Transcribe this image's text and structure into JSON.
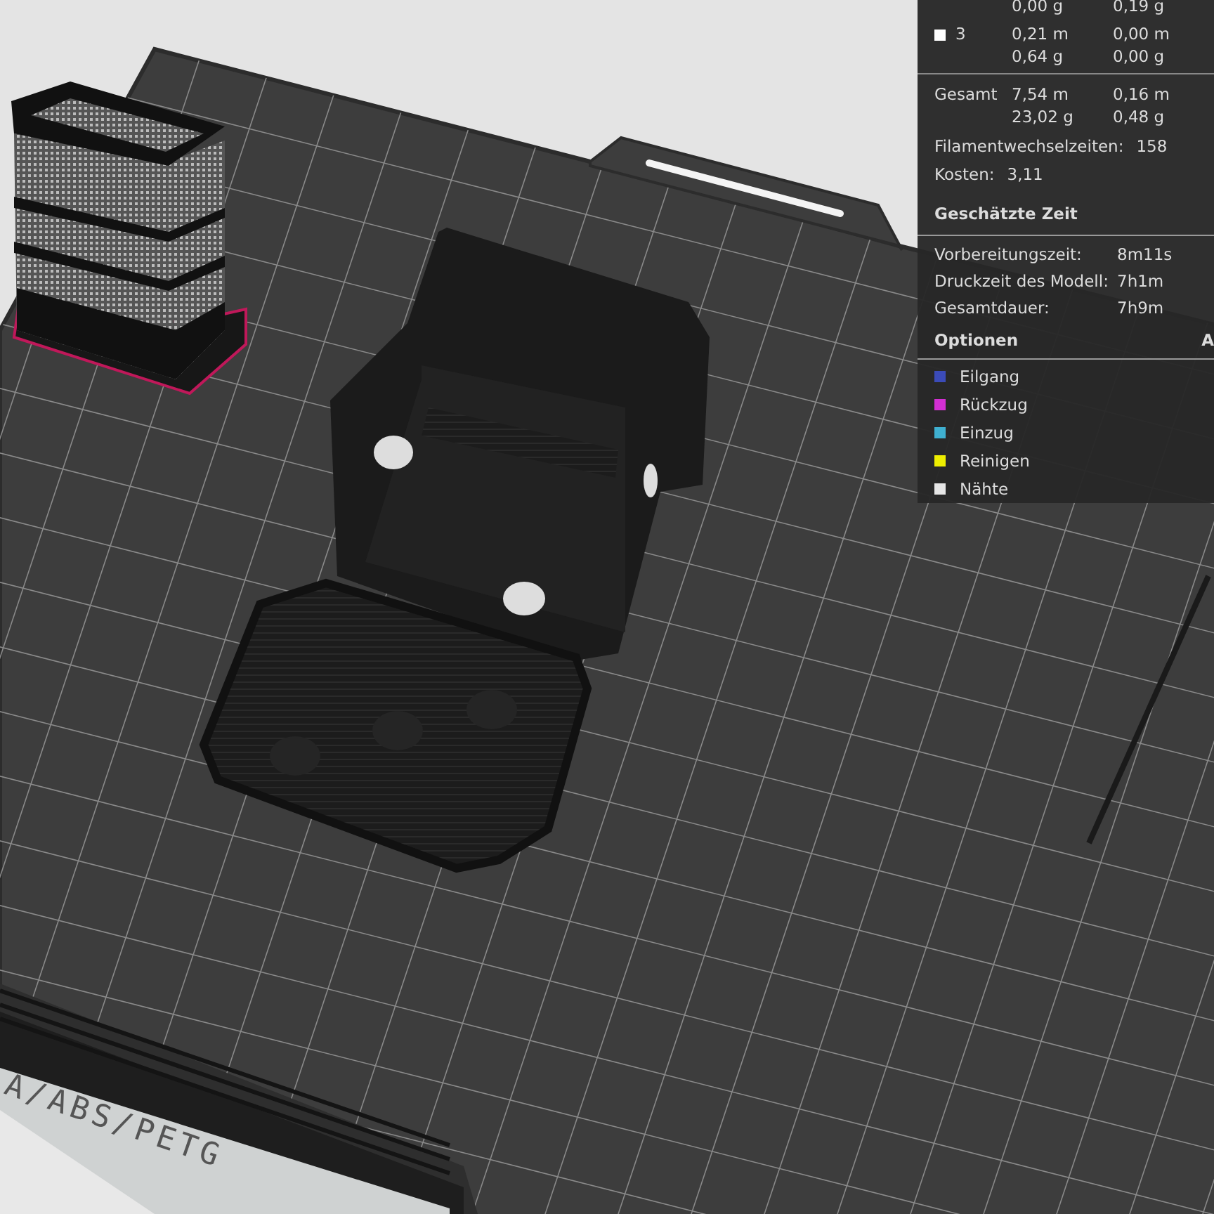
{
  "plate": {
    "label": "A/ABS/PETG"
  },
  "usage": {
    "rows": [
      {
        "kind": "partial",
        "columns": [
          [
            "0,00 g"
          ],
          [
            "0,19 g"
          ]
        ]
      },
      {
        "kind": "filament",
        "id": "3",
        "color": "#ffffff",
        "columns": [
          [
            "0,21 m",
            "0,64 g"
          ],
          [
            "0,00 m",
            "0,00 g"
          ]
        ]
      },
      {
        "kind": "total",
        "label": "Gesamt",
        "columns": [
          [
            "7,54 m",
            "23,02 g"
          ],
          [
            "0,16 m",
            "0,48 g"
          ]
        ]
      }
    ],
    "stats": [
      {
        "label": "Filamentwechselzeiten:",
        "value": "158"
      },
      {
        "label": "Kosten:",
        "value": "3,11"
      }
    ]
  },
  "time": {
    "title": "Geschätzte Zeit",
    "rows": [
      {
        "label": "Vorbereitungszeit:",
        "value": "8m11s"
      },
      {
        "label": "Druckzeit des Modell:",
        "value": "7h1m"
      },
      {
        "label": "Gesamtdauer:",
        "value": "7h9m"
      }
    ]
  },
  "legend": {
    "title": "Optionen",
    "column_2": "A",
    "items": [
      {
        "label": "Eilgang",
        "color": "#3b4bb8"
      },
      {
        "label": "Rückzug",
        "color": "#d32fd3"
      },
      {
        "label": "Einzug",
        "color": "#3fb0d0"
      },
      {
        "label": "Reinigen",
        "color": "#eeee00"
      },
      {
        "label": "Nähte",
        "color": "#e6e6e6"
      }
    ]
  }
}
